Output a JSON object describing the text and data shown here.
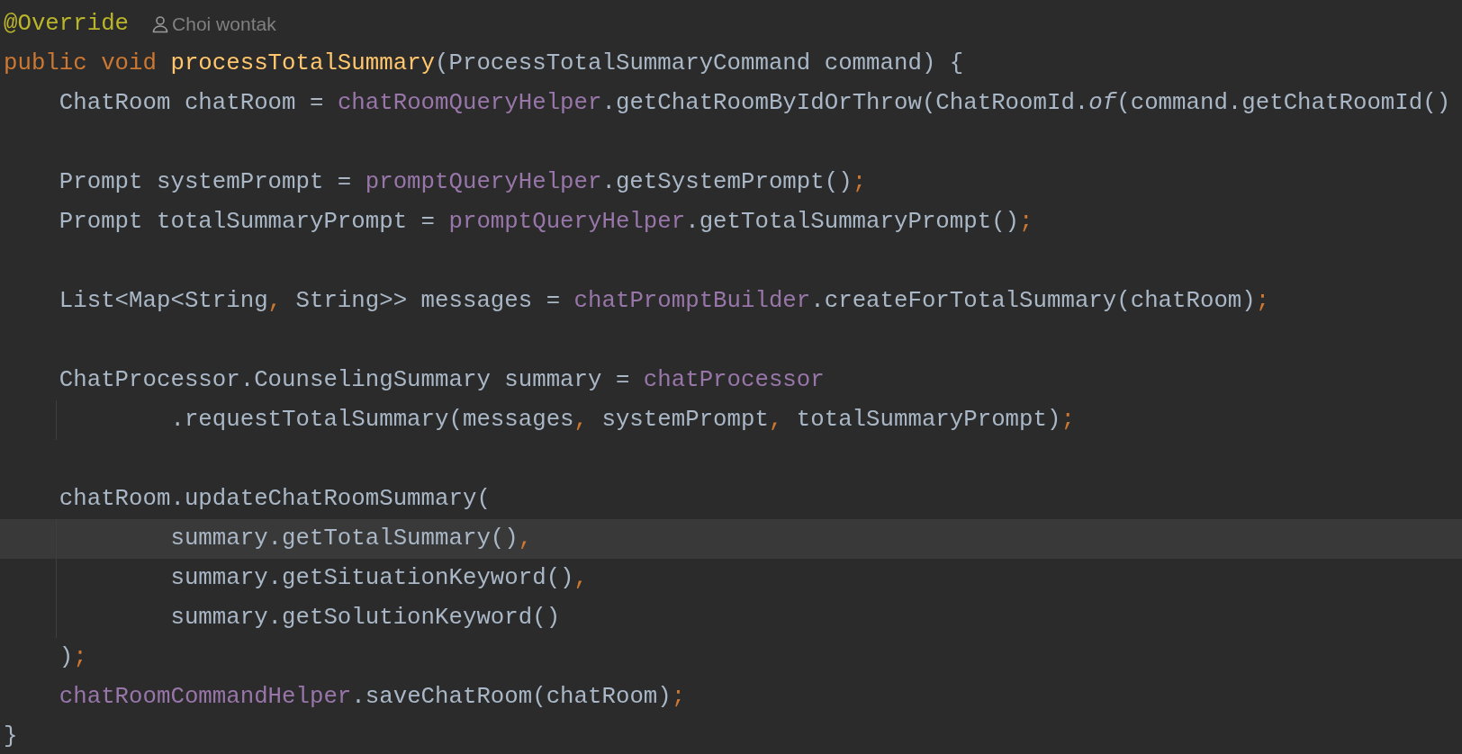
{
  "editor": {
    "lines": [
      {
        "current": false,
        "indent_guide": false,
        "tokens": [
          {
            "kind": "annotation",
            "text": "@Override"
          }
        ],
        "author_hint": "Choi wontak"
      },
      {
        "current": false,
        "indent_guide": false,
        "tokens": [
          {
            "kind": "keyword",
            "text": "public void "
          },
          {
            "kind": "method_decl",
            "text": "processTotalSummary"
          },
          {
            "kind": "plain",
            "text": "(ProcessTotalSummaryCommand command) {"
          }
        ]
      },
      {
        "current": false,
        "indent_guide": false,
        "tokens": [
          {
            "kind": "plain",
            "text": "    ChatRoom chatRoom = "
          },
          {
            "kind": "field",
            "text": "chatRoomQueryHelper"
          },
          {
            "kind": "plain",
            "text": ".getChatRoomByIdOrThrow(ChatRoomId."
          },
          {
            "kind": "static_call",
            "text": "of"
          },
          {
            "kind": "plain",
            "text": "(command.getChatRoomId()"
          }
        ]
      },
      {
        "current": false,
        "indent_guide": false
      },
      {
        "current": false,
        "indent_guide": false,
        "tokens": [
          {
            "kind": "plain",
            "text": "    Prompt systemPrompt = "
          },
          {
            "kind": "field",
            "text": "promptQueryHelper"
          },
          {
            "kind": "plain",
            "text": ".getSystemPrompt()"
          },
          {
            "kind": "punct",
            "text": ";"
          }
        ]
      },
      {
        "current": false,
        "indent_guide": false,
        "tokens": [
          {
            "kind": "plain",
            "text": "    Prompt totalSummaryPrompt = "
          },
          {
            "kind": "field",
            "text": "promptQueryHelper"
          },
          {
            "kind": "plain",
            "text": ".getTotalSummaryPrompt()"
          },
          {
            "kind": "punct",
            "text": ";"
          }
        ]
      },
      {
        "current": false,
        "indent_guide": false
      },
      {
        "current": false,
        "indent_guide": false,
        "tokens": [
          {
            "kind": "plain",
            "text": "    List<Map<String"
          },
          {
            "kind": "punct",
            "text": ", "
          },
          {
            "kind": "plain",
            "text": "String>> messages = "
          },
          {
            "kind": "field",
            "text": "chatPromptBuilder"
          },
          {
            "kind": "plain",
            "text": ".createForTotalSummary(chatRoom)"
          },
          {
            "kind": "punct",
            "text": ";"
          }
        ]
      },
      {
        "current": false,
        "indent_guide": false
      },
      {
        "current": false,
        "indent_guide": false,
        "tokens": [
          {
            "kind": "plain",
            "text": "    ChatProcessor.CounselingSummary summary = "
          },
          {
            "kind": "field",
            "text": "chatProcessor"
          }
        ]
      },
      {
        "current": false,
        "indent_guide": true,
        "tokens": [
          {
            "kind": "plain",
            "text": "            .requestTotalSummary(messages"
          },
          {
            "kind": "punct",
            "text": ", "
          },
          {
            "kind": "plain",
            "text": "systemPrompt"
          },
          {
            "kind": "punct",
            "text": ", "
          },
          {
            "kind": "plain",
            "text": "totalSummaryPrompt)"
          },
          {
            "kind": "punct",
            "text": ";"
          }
        ]
      },
      {
        "current": false,
        "indent_guide": false
      },
      {
        "current": false,
        "indent_guide": false,
        "tokens": [
          {
            "kind": "plain",
            "text": "    chatRoom.updateChatRoomSummary("
          }
        ]
      },
      {
        "current": true,
        "indent_guide": true,
        "tokens": [
          {
            "kind": "plain",
            "text": "            summary.getTotalSummary()"
          },
          {
            "kind": "punct",
            "text": ","
          }
        ]
      },
      {
        "current": false,
        "indent_guide": true,
        "tokens": [
          {
            "kind": "plain",
            "text": "            summary.getSituationKeyword()"
          },
          {
            "kind": "punct",
            "text": ","
          }
        ]
      },
      {
        "current": false,
        "indent_guide": true,
        "tokens": [
          {
            "kind": "plain",
            "text": "            summary.getSolutionKeyword()"
          }
        ]
      },
      {
        "current": false,
        "indent_guide": false,
        "tokens": [
          {
            "kind": "plain",
            "text": "    )"
          },
          {
            "kind": "punct",
            "text": ";"
          }
        ]
      },
      {
        "current": false,
        "indent_guide": false,
        "tokens": [
          {
            "kind": "field",
            "text": "    chatRoomCommandHelper"
          },
          {
            "kind": "plain",
            "text": ".saveChatRoom(chatRoom)"
          },
          {
            "kind": "punct",
            "text": ";"
          }
        ]
      },
      {
        "current": false,
        "indent_guide": false,
        "tokens": [
          {
            "kind": "plain",
            "text": "}"
          }
        ]
      }
    ]
  }
}
